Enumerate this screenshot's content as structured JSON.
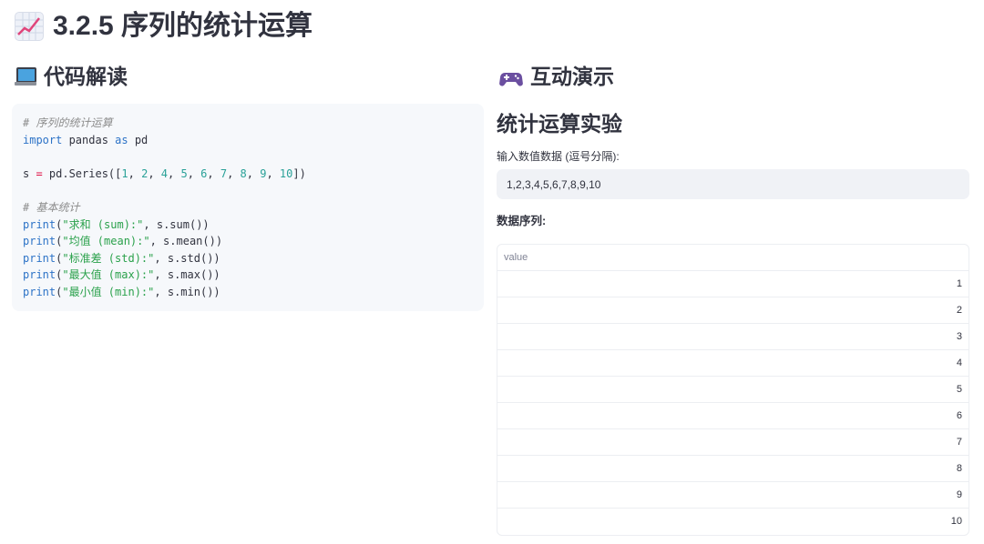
{
  "page": {
    "title": "3.2.5 序列的统计运算",
    "title_icon": "chart-increasing-icon"
  },
  "code_section": {
    "heading": "代码解读",
    "icon": "laptop-icon",
    "lines": [
      [
        {
          "t": "c",
          "v": "# 序列的统计运算"
        }
      ],
      [
        {
          "t": "k",
          "v": "import"
        },
        {
          "t": "p",
          "v": " pandas "
        },
        {
          "t": "k",
          "v": "as"
        },
        {
          "t": "p",
          "v": " pd"
        }
      ],
      [],
      [
        {
          "t": "p",
          "v": "s "
        },
        {
          "t": "o",
          "v": "="
        },
        {
          "t": "p",
          "v": " pd.Series(["
        },
        {
          "t": "n",
          "v": "1"
        },
        {
          "t": "p",
          "v": ", "
        },
        {
          "t": "n",
          "v": "2"
        },
        {
          "t": "p",
          "v": ", "
        },
        {
          "t": "n",
          "v": "4"
        },
        {
          "t": "p",
          "v": ", "
        },
        {
          "t": "n",
          "v": "5"
        },
        {
          "t": "p",
          "v": ", "
        },
        {
          "t": "n",
          "v": "6"
        },
        {
          "t": "p",
          "v": ", "
        },
        {
          "t": "n",
          "v": "7"
        },
        {
          "t": "p",
          "v": ", "
        },
        {
          "t": "n",
          "v": "8"
        },
        {
          "t": "p",
          "v": ", "
        },
        {
          "t": "n",
          "v": "9"
        },
        {
          "t": "p",
          "v": ", "
        },
        {
          "t": "n",
          "v": "10"
        },
        {
          "t": "p",
          "v": "])"
        }
      ],
      [],
      [
        {
          "t": "c",
          "v": "# 基本统计"
        }
      ],
      [
        {
          "t": "k",
          "v": "print"
        },
        {
          "t": "p",
          "v": "("
        },
        {
          "t": "s",
          "v": "\"求和 (sum):\""
        },
        {
          "t": "p",
          "v": ", s.sum())"
        }
      ],
      [
        {
          "t": "k",
          "v": "print"
        },
        {
          "t": "p",
          "v": "("
        },
        {
          "t": "s",
          "v": "\"均值 (mean):\""
        },
        {
          "t": "p",
          "v": ", s.mean())"
        }
      ],
      [
        {
          "t": "k",
          "v": "print"
        },
        {
          "t": "p",
          "v": "("
        },
        {
          "t": "s",
          "v": "\"标准差 (std):\""
        },
        {
          "t": "p",
          "v": ", s.std())"
        }
      ],
      [
        {
          "t": "k",
          "v": "print"
        },
        {
          "t": "p",
          "v": "("
        },
        {
          "t": "s",
          "v": "\"最大值 (max):\""
        },
        {
          "t": "p",
          "v": ", s.max())"
        }
      ],
      [
        {
          "t": "k",
          "v": "print"
        },
        {
          "t": "p",
          "v": "("
        },
        {
          "t": "s",
          "v": "\"最小值 (min):\""
        },
        {
          "t": "p",
          "v": ", s.min())"
        }
      ]
    ]
  },
  "demo_section": {
    "heading": "互动演示",
    "icon": "game-controller-icon",
    "subtitle": "统计运算实验",
    "input_label": "输入数值数据 (逗号分隔):",
    "input_value": "1,2,3,4,5,6,7,8,9,10",
    "series_label": "数据序列:",
    "table": {
      "column_header": "value",
      "values": [
        "1",
        "2",
        "3",
        "4",
        "5",
        "6",
        "7",
        "8",
        "9",
        "10"
      ]
    }
  },
  "colors": {
    "text": "#31333f",
    "code_bg": "#f6f8fb",
    "input_bg": "#f0f2f6",
    "keyword": "#2d73c7",
    "string": "#2aa14b",
    "number": "#2aa198",
    "comment": "#8c8c8c"
  }
}
